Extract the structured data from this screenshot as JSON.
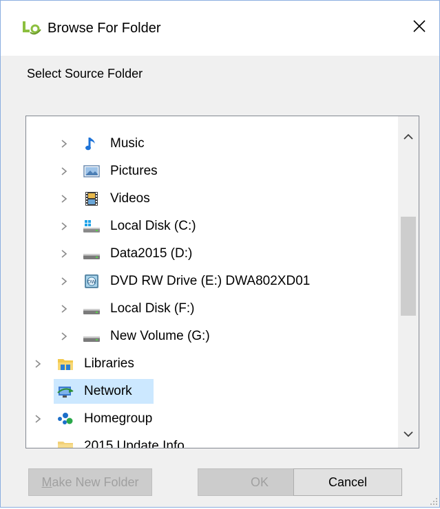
{
  "window": {
    "title": "Browse For Folder",
    "close_glyph": "✕",
    "app_icon": "app-logo-icon"
  },
  "prompt": "Select Source Folder",
  "tree": {
    "items": [
      {
        "label": "Music",
        "icon": "music-note-icon",
        "level": 1,
        "expandable": true
      },
      {
        "label": "Pictures",
        "icon": "pictures-folder-icon",
        "level": 1,
        "expandable": true
      },
      {
        "label": "Videos",
        "icon": "videos-folder-icon",
        "level": 1,
        "expandable": true
      },
      {
        "label": "Local Disk (C:)",
        "icon": "windows-drive-icon",
        "level": 1,
        "expandable": true
      },
      {
        "label": "Data2015 (D:)",
        "icon": "hard-drive-icon",
        "level": 1,
        "expandable": true
      },
      {
        "label": "DVD RW Drive (E:) DWA802XD01",
        "icon": "dvd-drive-icon",
        "level": 1,
        "expandable": true
      },
      {
        "label": "Local Disk (F:)",
        "icon": "hard-drive-icon",
        "level": 1,
        "expandable": true
      },
      {
        "label": "New Volume (G:)",
        "icon": "hard-drive-icon",
        "level": 1,
        "expandable": true
      },
      {
        "label": "Libraries",
        "icon": "libraries-icon",
        "level": 0,
        "expandable": true
      },
      {
        "label": "Network",
        "icon": "network-icon",
        "level": 0,
        "expandable": false,
        "selected": true
      },
      {
        "label": "Homegroup",
        "icon": "homegroup-icon",
        "level": 0,
        "expandable": true
      },
      {
        "label": "2015 Update Info",
        "icon": "folder-icon",
        "level": 0,
        "expandable": false
      }
    ]
  },
  "buttons": {
    "make_new_folder": "Make New Folder",
    "ok": "OK",
    "cancel": "Cancel"
  },
  "colors": {
    "selection": "#cce8ff",
    "dialog_bg": "#f0f0f0",
    "border": "#828790"
  }
}
